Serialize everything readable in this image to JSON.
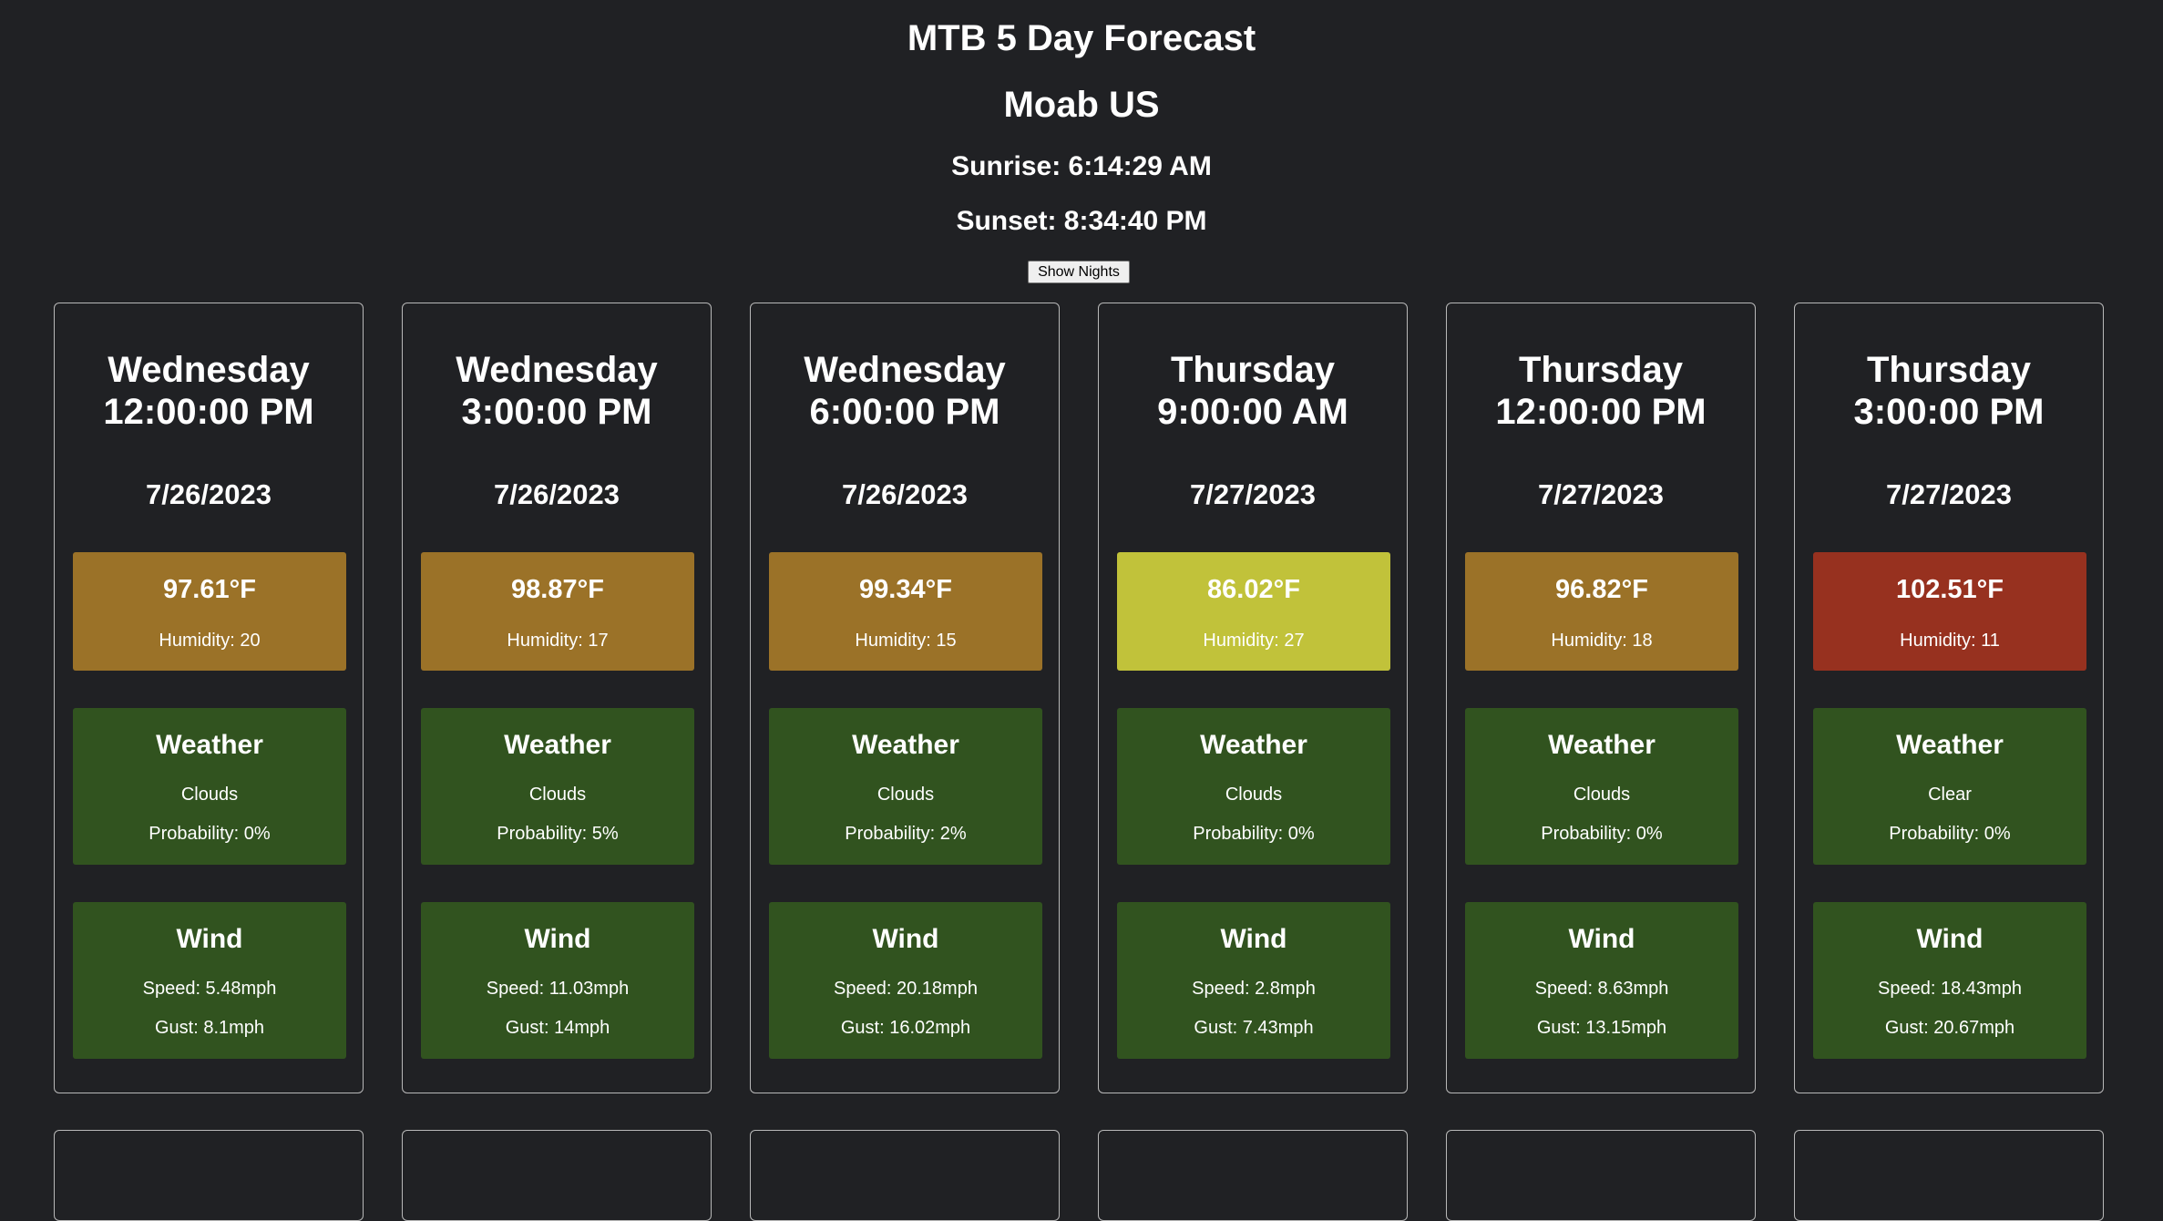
{
  "page": {
    "title": "MTB 5 Day Forecast",
    "location": "Moab US",
    "sunrise": "Sunrise: 6:14:29 AM",
    "sunset": "Sunset: 8:34:40 PM",
    "toggle_label": "Show Nights"
  },
  "labels": {
    "weather_heading": "Weather",
    "wind_heading": "Wind"
  },
  "colors": {
    "background": "#202124",
    "panel_green": "#31531f",
    "temp_hot": "#9b7228",
    "temp_mild": "#c1c23a",
    "temp_extreme": "#97311f"
  },
  "cards": [
    {
      "day": "Wednesday",
      "time": "12:00:00 PM",
      "date": "7/26/2023",
      "temp": "97.61°F",
      "humidity": "Humidity: 20",
      "temp_color": "#9b7228",
      "condition": "Clouds",
      "probability": "Probability: 0%",
      "speed": "Speed: 5.48mph",
      "gust": "Gust: 8.1mph"
    },
    {
      "day": "Wednesday",
      "time": "3:00:00 PM",
      "date": "7/26/2023",
      "temp": "98.87°F",
      "humidity": "Humidity: 17",
      "temp_color": "#9b7228",
      "condition": "Clouds",
      "probability": "Probability: 5%",
      "speed": "Speed: 11.03mph",
      "gust": "Gust: 14mph"
    },
    {
      "day": "Wednesday",
      "time": "6:00:00 PM",
      "date": "7/26/2023",
      "temp": "99.34°F",
      "humidity": "Humidity: 15",
      "temp_color": "#9b7228",
      "condition": "Clouds",
      "probability": "Probability: 2%",
      "speed": "Speed: 20.18mph",
      "gust": "Gust: 16.02mph"
    },
    {
      "day": "Thursday",
      "time": "9:00:00 AM",
      "date": "7/27/2023",
      "temp": "86.02°F",
      "humidity": "Humidity: 27",
      "temp_color": "#c1c23a",
      "condition": "Clouds",
      "probability": "Probability: 0%",
      "speed": "Speed: 2.8mph",
      "gust": "Gust: 7.43mph"
    },
    {
      "day": "Thursday",
      "time": "12:00:00 PM",
      "date": "7/27/2023",
      "temp": "96.82°F",
      "humidity": "Humidity: 18",
      "temp_color": "#9b7228",
      "condition": "Clouds",
      "probability": "Probability: 0%",
      "speed": "Speed: 8.63mph",
      "gust": "Gust: 13.15mph"
    },
    {
      "day": "Thursday",
      "time": "3:00:00 PM",
      "date": "7/27/2023",
      "temp": "102.51°F",
      "humidity": "Humidity: 11",
      "temp_color": "#97311f",
      "condition": "Clear",
      "probability": "Probability: 0%",
      "speed": "Speed: 18.43mph",
      "gust": "Gust: 20.67mph"
    }
  ]
}
